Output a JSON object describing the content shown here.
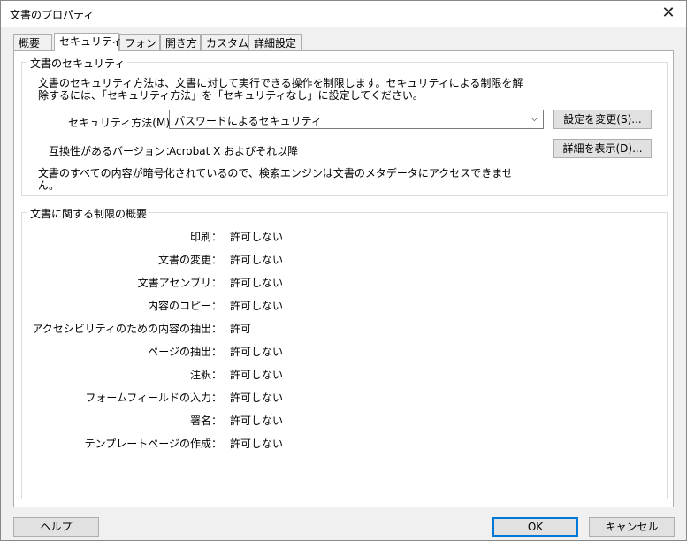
{
  "window": {
    "title": "文書のプロパティ"
  },
  "tabs": [
    {
      "label": "概要"
    },
    {
      "label": "セキュリティ"
    },
    {
      "label": "フォント"
    },
    {
      "label": "開き方"
    },
    {
      "label": "カスタム"
    },
    {
      "label": "詳細設定"
    }
  ],
  "security": {
    "legend": "文書のセキュリティ",
    "description_line1": "文書のセキュリティ方法は、文書に対して実行できる操作を制限します。セキュリティによる制限を解",
    "description_line2": "除するには、「セキュリティ方法」を「セキュリティなし」に設定してください。",
    "method_label": "セキュリティ方法(M)：",
    "method_value": "パスワードによるセキュリティ",
    "change_button": "設定を変更(S)...",
    "compat_label": "互換性があるバージョン：",
    "compat_value": "Acrobat X およびそれ以降",
    "details_button": "詳細を表示(D)...",
    "note_line1": "文書のすべての内容が暗号化されているので、検索エンジンは文書のメタデータにアクセスできませ",
    "note_line2": "ん。"
  },
  "restrictions": {
    "legend": "文書に関する制限の概要",
    "rows": [
      {
        "label": "印刷：",
        "value": "許可しない"
      },
      {
        "label": "文書の変更：",
        "value": "許可しない"
      },
      {
        "label": "文書アセンブリ：",
        "value": "許可しない"
      },
      {
        "label": "内容のコピー：",
        "value": "許可しない"
      },
      {
        "label": "アクセシビリティのための内容の抽出：",
        "value": "許可"
      },
      {
        "label": "ページの抽出：",
        "value": "許可しない"
      },
      {
        "label": "注釈：",
        "value": "許可しない"
      },
      {
        "label": "フォームフィールドの入力：",
        "value": "許可しない"
      },
      {
        "label": "署名：",
        "value": "許可しない"
      },
      {
        "label": "テンプレートページの作成：",
        "value": "許可しない"
      }
    ]
  },
  "footer": {
    "help": "ヘルプ",
    "ok": "OK",
    "cancel": "キャンセル"
  }
}
